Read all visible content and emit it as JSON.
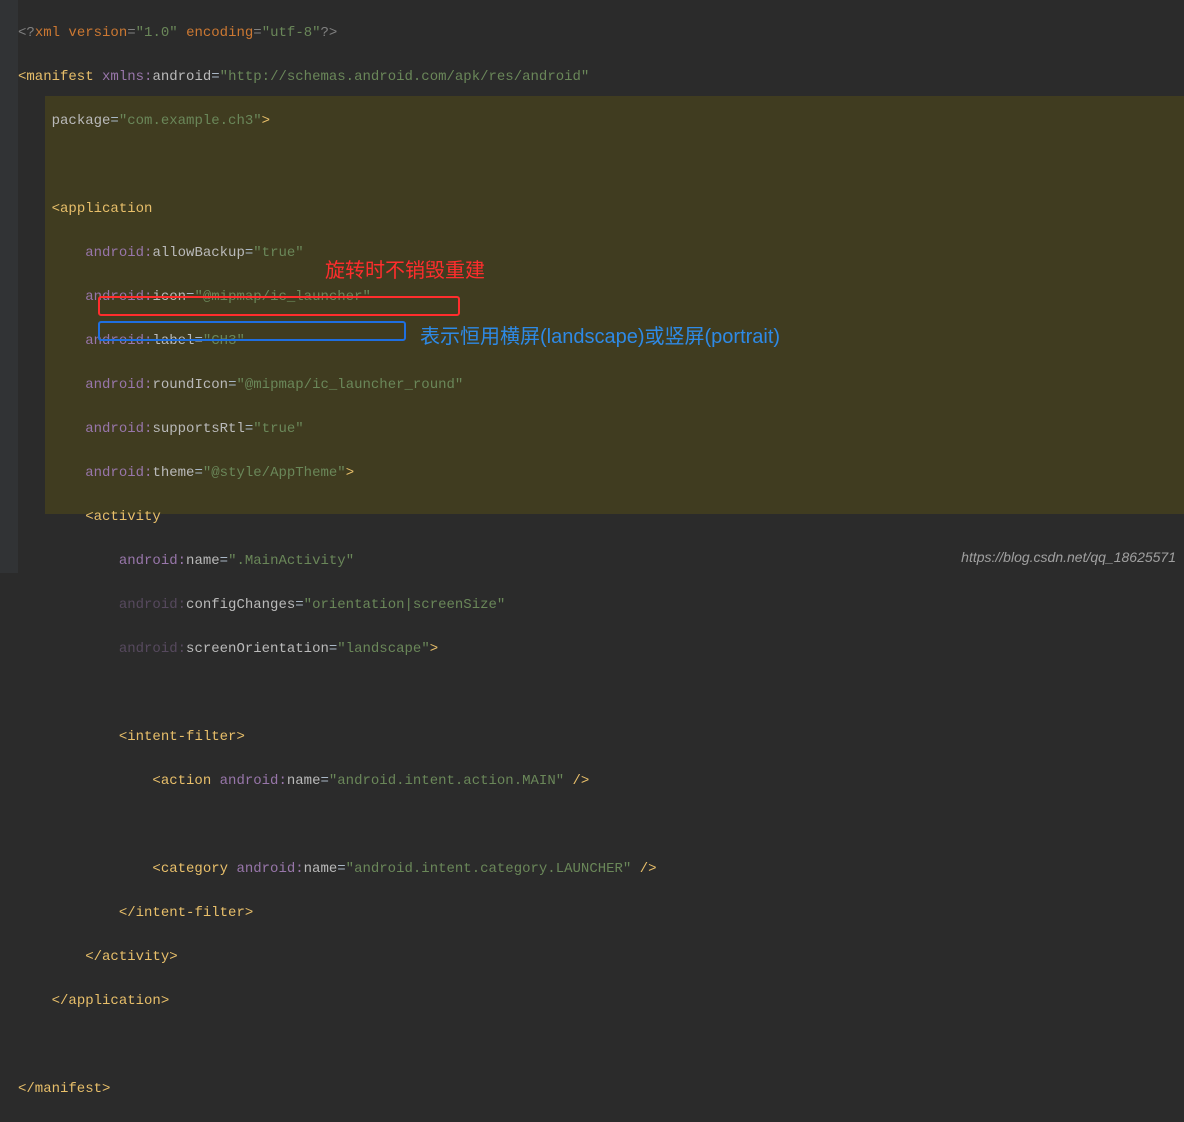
{
  "xml_decl": {
    "version": "1.0",
    "encoding": "utf-8"
  },
  "manifest": {
    "xmlns": "http://schemas.android.com/apk/res/android",
    "package": "com.example.ch3"
  },
  "application": {
    "allowBackup": "true",
    "icon": "@mipmap/ic_launcher",
    "label": "CH3",
    "roundIcon": "@mipmap/ic_launcher_round",
    "supportsRtl": "true",
    "theme": "@style/AppTheme"
  },
  "activity": {
    "name": ".MainActivity",
    "configChanges": "orientation|screenSize",
    "screenOrientation": "landscape"
  },
  "intent_filter": {
    "action_name": "android.intent.action.MAIN",
    "category_name": "android.intent.category.LAUNCHER"
  },
  "annotations": {
    "red": "旋转时不销毁重建",
    "blue": "表示恒用横屏(landscape)或竖屏(portrait)"
  },
  "watermark": "https://blog.csdn.net/qq_18625571"
}
